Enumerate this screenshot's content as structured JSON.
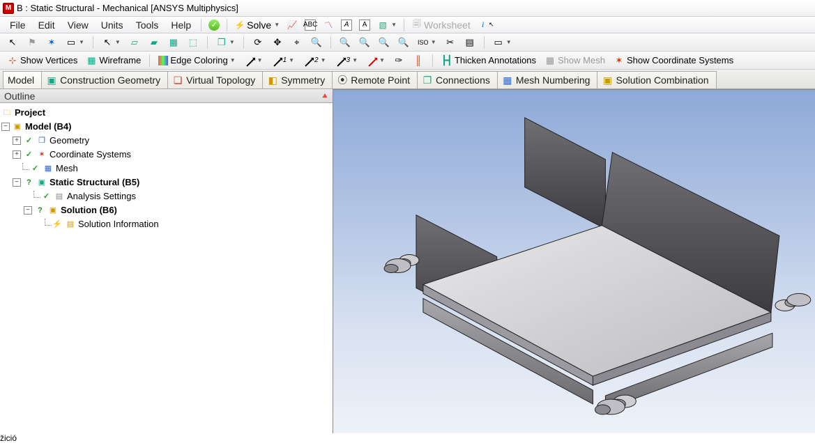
{
  "titlebar": {
    "title": "B : Static Structural - Mechanical [ANSYS Multiphysics]"
  },
  "menu": {
    "file": "File",
    "edit": "Edit",
    "view": "View",
    "units": "Units",
    "tools": "Tools",
    "help": "Help",
    "solve": "Solve",
    "worksheet": "Worksheet",
    "glyphs": {
      "abc": "ABC",
      "a": "A"
    }
  },
  "tb3": {
    "show_vertices": "Show Vertices",
    "wireframe": "Wireframe",
    "edge_coloring": "Edge Coloring",
    "thicken": "Thicken Annotations",
    "show_mesh": "Show Mesh",
    "show_cs": "Show Coordinate Systems"
  },
  "tabs": {
    "model": "Model",
    "construction": "Construction Geometry",
    "virtual": "Virtual Topology",
    "symmetry": "Symmetry",
    "remote": "Remote Point",
    "connections": "Connections",
    "mesh_num": "Mesh Numbering",
    "sol_comb": "Solution Combination"
  },
  "outline_title": "Outline",
  "tree": {
    "project": "Project",
    "model": "Model (B4)",
    "geometry": "Geometry",
    "cs": "Coordinate Systems",
    "mesh": "Mesh",
    "static": "Static Structural (B5)",
    "analysis": "Analysis Settings",
    "solution": "Solution (B6)",
    "solinfo": "Solution Information"
  }
}
